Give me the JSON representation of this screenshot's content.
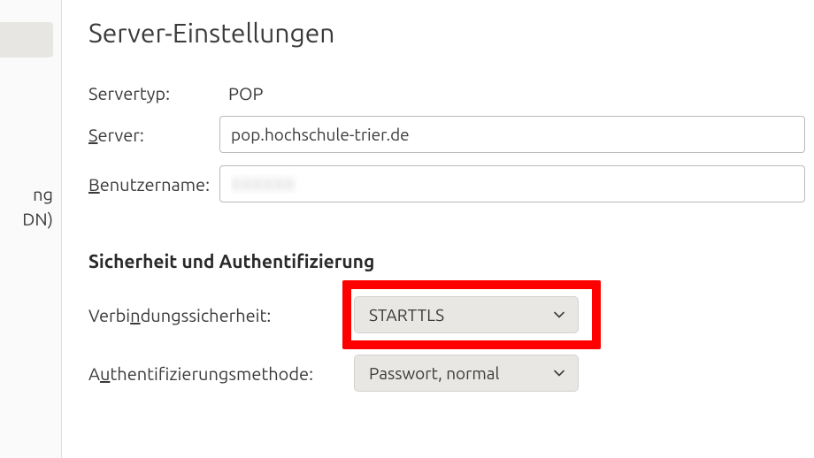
{
  "sidebar": {
    "partial_label_line1": "ng",
    "partial_label_line2": "DN)"
  },
  "server_settings": {
    "title": "Server-Einstellungen",
    "server_type_label": "Servertyp:",
    "server_type_value": "POP",
    "server_label_prefix": "S",
    "server_label_rest": "erver:",
    "server_value": "pop.hochschule-trier.de",
    "username_label_prefix": "B",
    "username_label_rest": "enutzername:",
    "username_value": "XXXXXX"
  },
  "security": {
    "heading": "Sicherheit und Authentifizierung",
    "conn_sec_label_pre": "Verbi",
    "conn_sec_label_u": "n",
    "conn_sec_label_post": "dungssicherheit:",
    "conn_sec_value": "STARTTLS",
    "auth_label_pre": "A",
    "auth_label_u": "u",
    "auth_label_post": "thentifizierungsmethode:",
    "auth_value": "Passwort, normal"
  },
  "highlight": {
    "target": "connection-security-select"
  }
}
